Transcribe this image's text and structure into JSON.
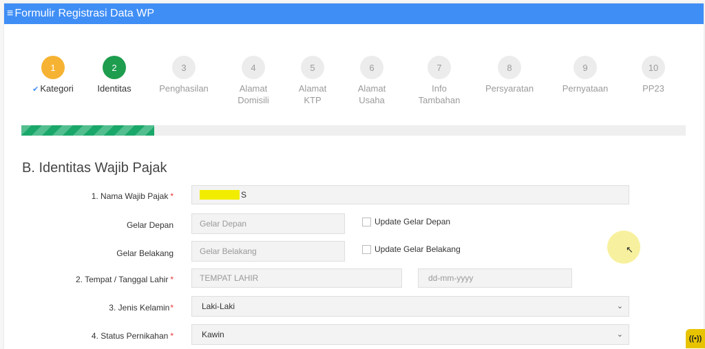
{
  "header": {
    "menu_icon": "hamburger-icon",
    "title": "Formulir Registrasi Data WP"
  },
  "steps": [
    {
      "number": "1",
      "label": "Kategori",
      "state": "done",
      "color": "#f6b333"
    },
    {
      "number": "2",
      "label": "Identitas",
      "state": "active",
      "color": "#1e9d4e"
    },
    {
      "number": "3",
      "label": "Penghasilan",
      "state": "pending"
    },
    {
      "number": "4",
      "label_lines": [
        "Alamat",
        "Domisili"
      ],
      "state": "pending"
    },
    {
      "number": "5",
      "label_lines": [
        "Alamat",
        "KTP"
      ],
      "state": "pending"
    },
    {
      "number": "6",
      "label_lines": [
        "Alamat",
        "Usaha"
      ],
      "state": "pending"
    },
    {
      "number": "7",
      "label_lines": [
        "Info",
        "Tambahan"
      ],
      "state": "pending"
    },
    {
      "number": "8",
      "label": "Persyaratan",
      "state": "pending"
    },
    {
      "number": "9",
      "label": "Pernyataan",
      "state": "pending"
    },
    {
      "number": "10",
      "label": "PP23",
      "state": "pending"
    }
  ],
  "progress": {
    "fraction": 0.2,
    "color": "#1aa86a"
  },
  "section": {
    "title": "B. Identitas Wajib Pajak"
  },
  "form": {
    "nama": {
      "label": "1. Nama Wajib Pajak",
      "required_mark": "*",
      "value": "S"
    },
    "gelar_depan": {
      "label": "Gelar Depan",
      "placeholder": "Gelar Depan",
      "checkbox_label": "Update Gelar Depan"
    },
    "gelar_belakang": {
      "label": "Gelar Belakang",
      "placeholder": "Gelar Belakang",
      "checkbox_label": "Update Gelar Belakang"
    },
    "ttl": {
      "label": "2. Tempat / Tanggal Lahir",
      "required_mark": "*",
      "place_placeholder": "TEMPAT LAHIR",
      "date_placeholder": "dd-mm-yyyy"
    },
    "jenis_kelamin": {
      "label": "3. Jenis Kelamin",
      "required_mark": "*",
      "value": "Laki-Laki"
    },
    "status_pernikahan": {
      "label": "4. Status Pernikahan",
      "required_mark": "*",
      "value": "Kawin"
    }
  },
  "colors": {
    "header": "#3f8ef6",
    "required": "#ee3333"
  }
}
